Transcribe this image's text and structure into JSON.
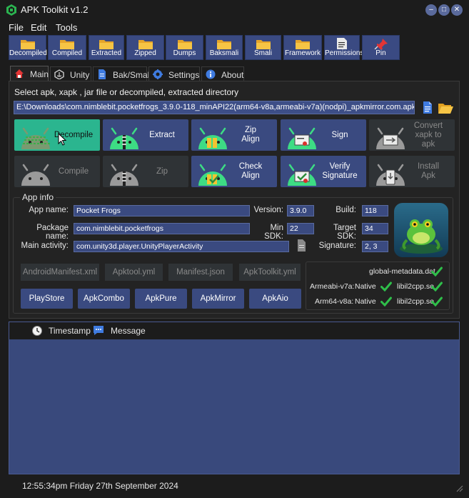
{
  "window": {
    "title": "APK Toolkit v1.2",
    "buttons": [
      "–",
      "□",
      "✕"
    ]
  },
  "menu": [
    "File",
    "Edit",
    "Tools"
  ],
  "toolbar": [
    {
      "label": "Decompiled",
      "icon": "folder-icon"
    },
    {
      "label": "Compiled",
      "icon": "folder-icon"
    },
    {
      "label": "Extracted",
      "icon": "folder-icon"
    },
    {
      "label": "Zipped",
      "icon": "folder-icon"
    },
    {
      "label": "Dumps",
      "icon": "folder-icon"
    },
    {
      "label": "Baksmali",
      "icon": "folder-icon"
    },
    {
      "label": "Smali",
      "icon": "folder-icon"
    },
    {
      "label": "Framework",
      "icon": "folder-icon"
    },
    {
      "label": "Permissions",
      "icon": "document-icon"
    },
    {
      "label": "Pin",
      "icon": "pin-icon"
    }
  ],
  "tabs": [
    {
      "label": "Main",
      "icon": "home-icon"
    },
    {
      "label": "Unity",
      "icon": "unity-icon"
    },
    {
      "label": "Bak/Smali",
      "icon": "document-icon"
    },
    {
      "label": "Settings",
      "icon": "gear-icon"
    },
    {
      "label": "About",
      "icon": "info-icon"
    }
  ],
  "main": {
    "prompt": "Select apk, xapk , jar file or decompiled, extracted directory",
    "path": "E:\\Downloads\\com.nimblebit.pocketfrogs_3.9.0-118_minAPI22(arm64-v8a,armeabi-v7a)(nodpi)_apkmirror.com.apk",
    "actions_row1": [
      "Decompile",
      "Extract",
      "Zip\nAlign",
      "Sign",
      "Convert\nxapk to\napk"
    ],
    "actions_row2": [
      "Compile",
      "Zip",
      "Check\nAlign",
      "Verify\nSignature",
      "Install\nApk"
    ]
  },
  "app_info": {
    "title": "App info",
    "app_name_label": "App name:",
    "app_name": "Pocket Frogs",
    "version_label": "Version:",
    "version": "3.9.0",
    "build_label": "Build:",
    "build": "118",
    "package_label": "Package name:",
    "package": "com.nimblebit.pocketfrogs",
    "min_sdk_label": "Min SDK:",
    "min_sdk": "22",
    "target_sdk_label": "Target SDK:",
    "target_sdk": "34",
    "activity_label": "Main activity:",
    "activity": "com.unity3d.player.UnityPlayerActivity",
    "signature_label": "Signature:",
    "signature": "2, 3",
    "files": [
      "AndroidManifest.xml",
      "Apktool.yml",
      "Manifest.json",
      "ApkToolkit.yml"
    ],
    "stores": [
      "PlayStore",
      "ApkCombo",
      "ApkPure",
      "ApkMirror",
      "ApkAio"
    ],
    "libs": {
      "metadata": "global-metadata.dat",
      "armv7_label": "Armeabi-v7a:",
      "armv7_type": "Native",
      "armv7_lib": "libil2cpp.so",
      "arm64_label": "Arm64-v8a:",
      "arm64_type": "Native",
      "arm64_lib": "libil2cpp.so"
    }
  },
  "log": {
    "columns": [
      "Timestamp",
      "Message"
    ]
  },
  "status": "12:55:34pm  Friday 27th September 2024",
  "colors": {
    "accent": "#3a4a80",
    "active_button": "#2bb58f",
    "check": "#2fbf4a"
  }
}
